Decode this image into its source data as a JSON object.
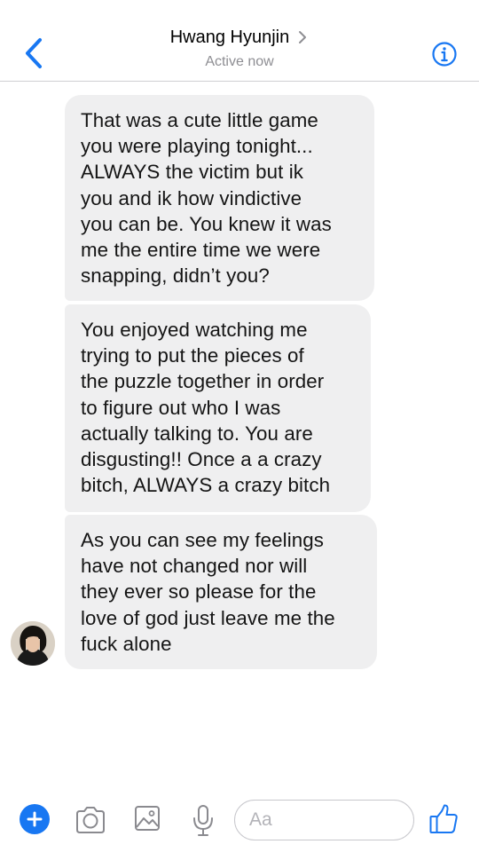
{
  "header": {
    "title": "Hwang Hyunjin",
    "status": "Active now"
  },
  "messages": [
    {
      "sender": "contact",
      "text": "That was a cute little game\nyou were playing tonight...\nALWAYS the victim but ik\nyou and ik how vindictive\nyou can be. You knew it was\nme the entire time we were\nsnapping, didn’t you?"
    },
    {
      "sender": "contact",
      "text": "You enjoyed watching me\ntrying to put the pieces of\nthe puzzle together in order\nto figure out who I was\nactually talking to. You are\ndisgusting!! Once a a crazy\nbitch, ALWAYS a crazy bitch"
    },
    {
      "sender": "contact",
      "text": "As you can see my feelings\nhave not changed nor will\nthey ever so please for the\nlove of god just leave me the\nfuck alone"
    }
  ],
  "composer": {
    "placeholder": "Aa",
    "value": ""
  },
  "icons": {
    "back": "chevron-left-icon",
    "title_chevron": "chevron-right-icon",
    "info": "info-icon",
    "plus": "plus-icon",
    "camera": "camera-icon",
    "gallery": "image-icon",
    "mic": "microphone-icon",
    "like": "thumbs-up-icon"
  },
  "colors": {
    "accent": "#1877f2",
    "bubble_incoming": "#efeff0",
    "subtitle": "#8e8e93",
    "divider": "#cfcfd3"
  }
}
